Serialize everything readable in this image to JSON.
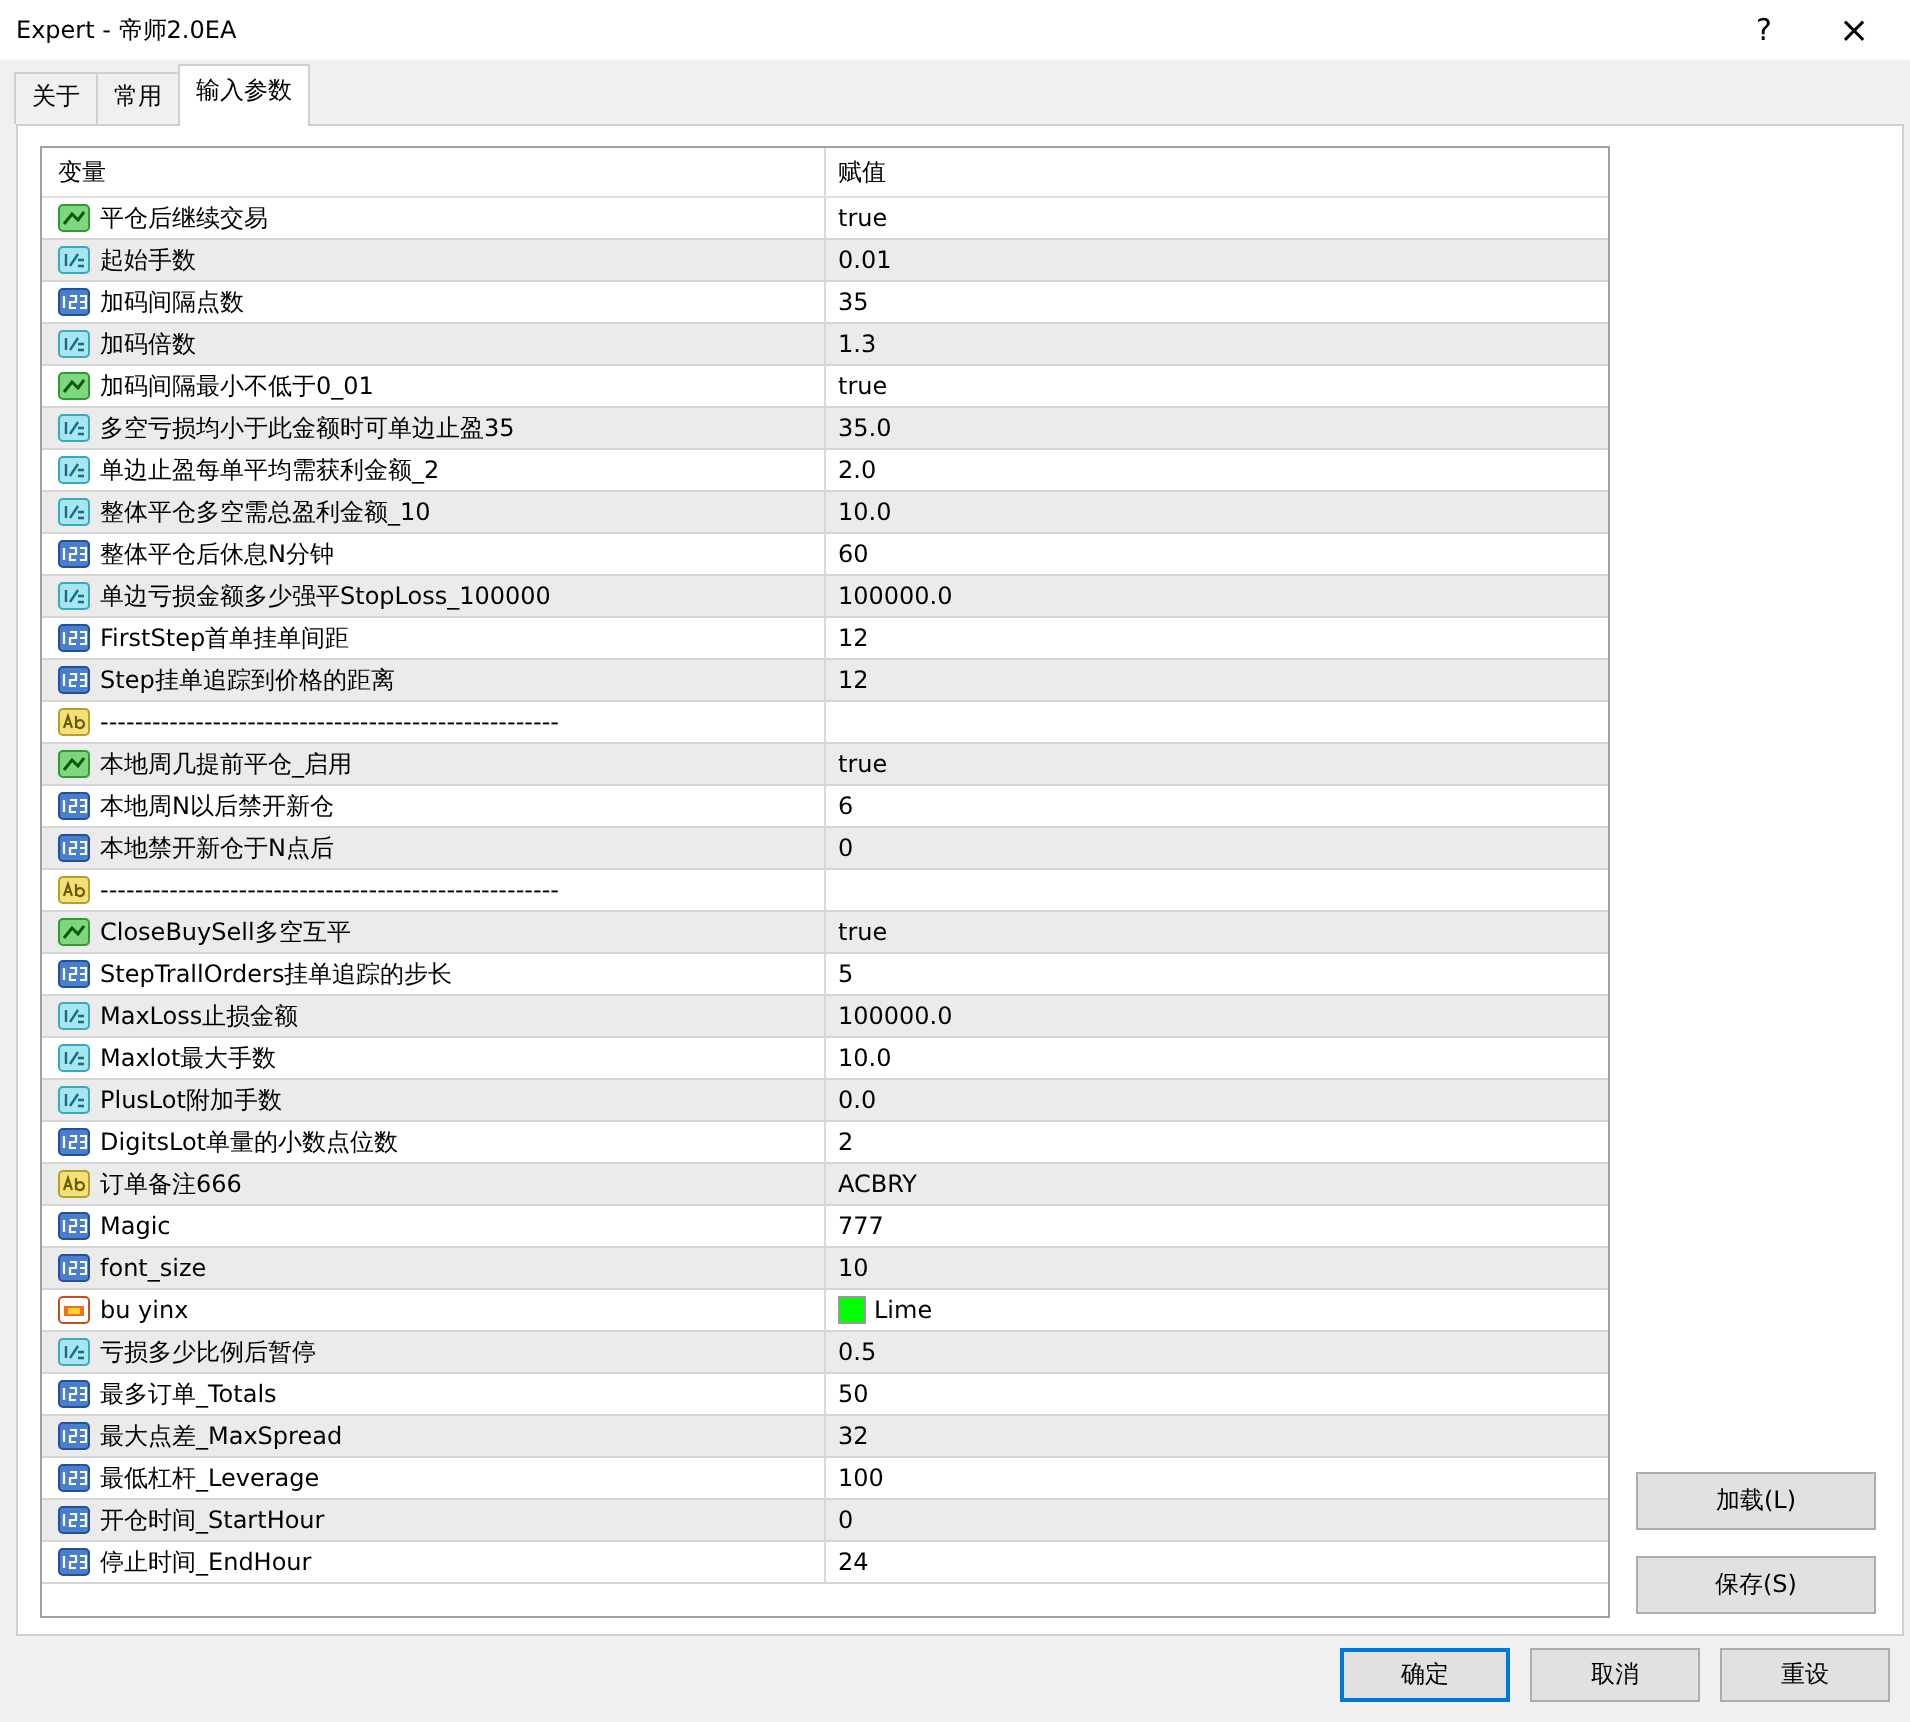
{
  "window": {
    "title": "Expert - 帝师2.0EA",
    "help": "?",
    "close": "×"
  },
  "tabs": [
    {
      "label": "关于",
      "selected": false
    },
    {
      "label": "常用",
      "selected": false
    },
    {
      "label": "输入参数",
      "selected": true
    }
  ],
  "table": {
    "columns": [
      "变量",
      "赋值"
    ],
    "rows": [
      {
        "kind": "bool",
        "name": "平仓后继续交易",
        "value": "true"
      },
      {
        "kind": "double",
        "name": "起始手数",
        "value": "0.01"
      },
      {
        "kind": "int",
        "name": "加码间隔点数",
        "value": "35"
      },
      {
        "kind": "double",
        "name": "加码倍数",
        "value": "1.3"
      },
      {
        "kind": "bool",
        "name": "加码间隔最小不低于0_01",
        "value": "true"
      },
      {
        "kind": "double",
        "name": "多空亏损均小于此金额时可单边止盈35",
        "value": "35.0"
      },
      {
        "kind": "double",
        "name": "单边止盈每单平均需获利金额_2",
        "value": "2.0"
      },
      {
        "kind": "double",
        "name": "整体平仓多空需总盈利金额_10",
        "value": "10.0"
      },
      {
        "kind": "int",
        "name": "整体平仓后休息N分钟",
        "value": "60"
      },
      {
        "kind": "double",
        "name": "单边亏损金额多少强平StopLoss_100000",
        "value": "100000.0"
      },
      {
        "kind": "int",
        "name": "FirstStep首单挂单间距",
        "value": "12"
      },
      {
        "kind": "int",
        "name": "Step挂单追踪到价格的距离",
        "value": "12"
      },
      {
        "kind": "string",
        "name": "-----------------------------------------------------"
      },
      {
        "kind": "bool",
        "name": "本地周几提前平仓_启用",
        "value": "true"
      },
      {
        "kind": "int",
        "name": "本地周N以后禁开新仓",
        "value": "6"
      },
      {
        "kind": "int",
        "name": "本地禁开新仓于N点后",
        "value": "0"
      },
      {
        "kind": "string",
        "name": "-----------------------------------------------------"
      },
      {
        "kind": "bool",
        "name": "CloseBuySell多空互平",
        "value": "true"
      },
      {
        "kind": "int",
        "name": "StepTrallOrders挂单追踪的步长",
        "value": "5"
      },
      {
        "kind": "double",
        "name": "MaxLoss止损金额",
        "value": "100000.0"
      },
      {
        "kind": "double",
        "name": "Maxlot最大手数",
        "value": "10.0"
      },
      {
        "kind": "double",
        "name": "PlusLot附加手数",
        "value": "0.0"
      },
      {
        "kind": "int",
        "name": "DigitsLot单量的小数点位数",
        "value": "2"
      },
      {
        "kind": "string",
        "name": "订单备注666",
        "value": "ACBRY"
      },
      {
        "kind": "int",
        "name": "Magic",
        "value": "777"
      },
      {
        "kind": "int",
        "name": "font_size",
        "value": "10"
      },
      {
        "kind": "color",
        "name": "bu yinx",
        "value": "Lime",
        "color": "#00ff00"
      },
      {
        "kind": "double",
        "name": "亏损多少比例后暂停",
        "value": "0.5"
      },
      {
        "kind": "int",
        "name": "最多订单_Totals",
        "value": "50"
      },
      {
        "kind": "int",
        "name": "最大点差_MaxSpread",
        "value": "32"
      },
      {
        "kind": "int",
        "name": "最低杠杆_Leverage",
        "value": "100"
      },
      {
        "kind": "int",
        "name": "开仓时间_StartHour",
        "value": "0"
      },
      {
        "kind": "int",
        "name": "停止时间_EndHour",
        "value": "24"
      }
    ]
  },
  "side_buttons": [
    "加载(L)",
    "保存(S)"
  ],
  "buttons": [
    {
      "label": "确定",
      "default": true
    },
    {
      "label": "取消",
      "default": false
    },
    {
      "label": "重设",
      "default": false
    }
  ]
}
